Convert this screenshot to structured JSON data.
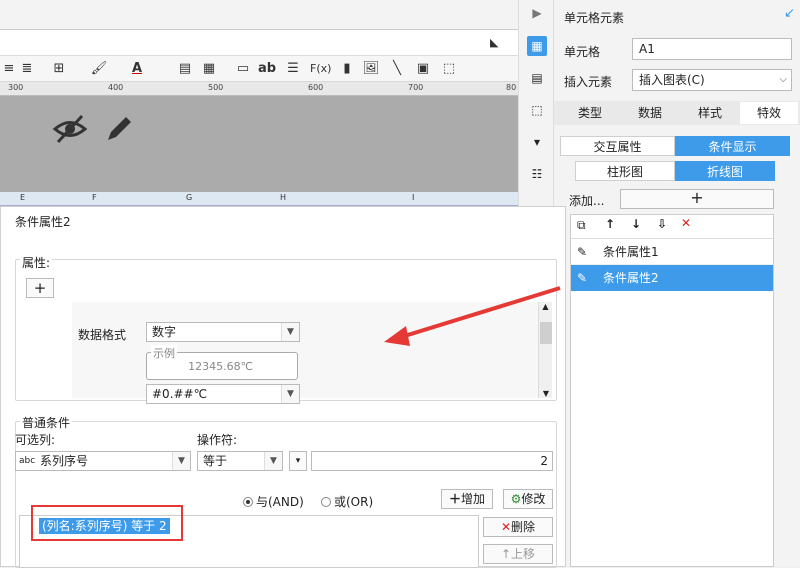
{
  "panel": {
    "title": "单元格元素",
    "cell_label": "单元格",
    "cell_value": "A1",
    "insert_label": "插入元素",
    "insert_value": "插入图表(C)",
    "tabs": [
      "类型",
      "数据",
      "样式",
      "特效"
    ],
    "subtabs": [
      "交互属性",
      "条件显示"
    ],
    "chart_types": [
      "柱形图",
      "折线图"
    ],
    "add_label": "添加...",
    "add_button": "+",
    "list_items": [
      "条件属性1",
      "条件属性2"
    ]
  },
  "ruler": {
    "ticks": [
      "300",
      "400",
      "500",
      "600",
      "700",
      "80"
    ]
  },
  "columns": [
    "E",
    "F",
    "G",
    "H",
    "I"
  ],
  "dialog": {
    "title": "条件属性2",
    "props_label": "属性:",
    "add_symbol": "+",
    "format_label": "数据格式",
    "format_value": "数字",
    "example_label": "示例",
    "example_value": "12345.68℃",
    "pattern_value": "#0.##℃",
    "common_label": "普通条件",
    "column_label": "可选列:",
    "column_value": "系列序号",
    "operator_label": "操作符:",
    "operator_value": "等于",
    "value": "2",
    "and_label": "与(AND)",
    "or_label": "或(OR)",
    "add_btn": "增加",
    "modify_btn": "修改",
    "delete_btn": "删除",
    "up_btn": "上移",
    "condition_text": "(列名:系列序号) 等于 2"
  },
  "colors": {
    "accent": "#3d9be9",
    "annotation": "#e53935"
  }
}
